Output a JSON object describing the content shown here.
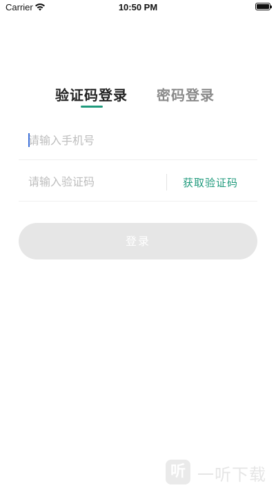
{
  "status_bar": {
    "carrier": "Carrier",
    "time": "10:50 PM",
    "wifi_icon": "wifi-icon",
    "battery_icon": "battery-icon"
  },
  "tabs": [
    {
      "label": "验证码登录",
      "active": true
    },
    {
      "label": "密码登录",
      "active": false
    }
  ],
  "form": {
    "phone": {
      "value": "",
      "placeholder": "请输入手机号"
    },
    "code": {
      "value": "",
      "placeholder": "请输入验证码"
    },
    "get_code_label": "获取验证码",
    "login_label": "登录"
  },
  "watermark": {
    "logo_text": "听",
    "text": "一听下载"
  },
  "colors": {
    "accent": "#1f9a7c",
    "button_disabled": "#e6e6e6",
    "placeholder": "#bdbdbd",
    "caret": "#3b6fd8"
  }
}
